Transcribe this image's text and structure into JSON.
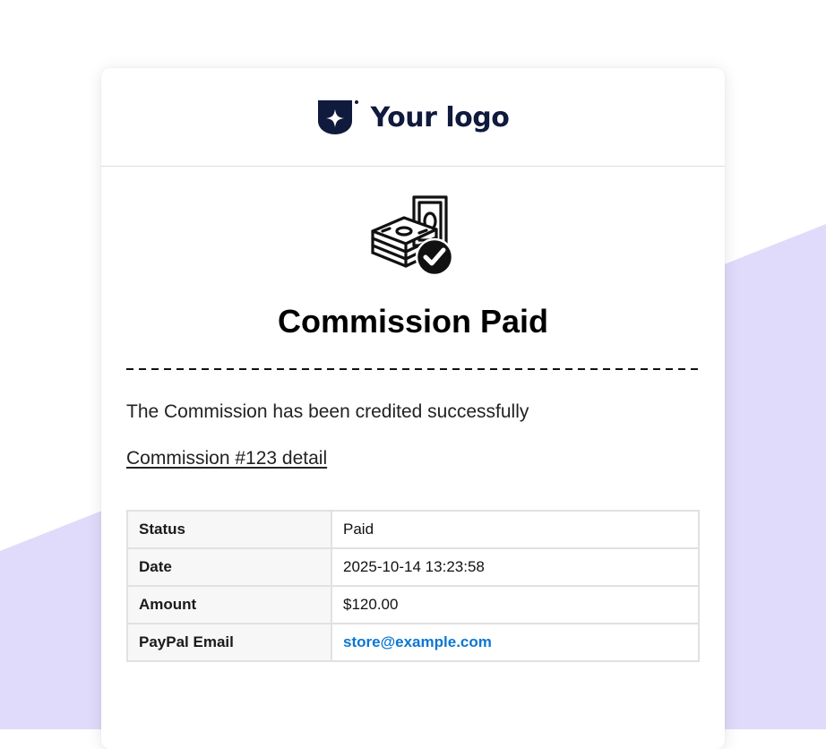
{
  "logo": {
    "text": "Your logo"
  },
  "email": {
    "title": "Commission Paid",
    "message": "The Commission has been credited successfully",
    "detail_link": "Commission #123 detail"
  },
  "details": {
    "rows": [
      {
        "label": "Status",
        "value": "Paid"
      },
      {
        "label": "Date",
        "value": "2025-10-14 13:23:58"
      },
      {
        "label": "Amount",
        "value": "$120.00"
      },
      {
        "label": "PayPal Email",
        "value": "store@example.com"
      }
    ]
  },
  "colors": {
    "background_accent": "#e0dbfb",
    "logo": "#101a3c",
    "link": "#0b77d1"
  },
  "icons": {
    "logo_mark": "shield-star-icon",
    "hero": "money-stack-check-icon"
  }
}
